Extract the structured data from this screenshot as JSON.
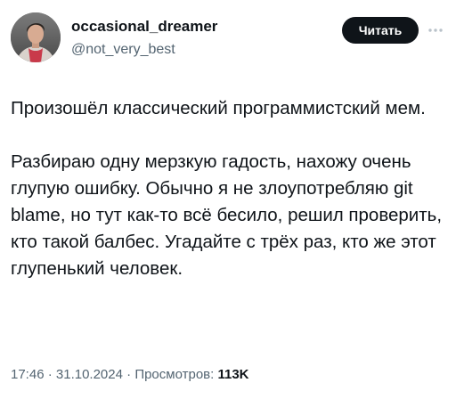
{
  "author": {
    "display_name": "occasional_dreamer",
    "handle": "@not_very_best"
  },
  "follow_button": {
    "label": "Читать"
  },
  "more_icon": "ellipsis-icon",
  "tweet": {
    "paragraphs": [
      "Произошёл классический программистский мем.",
      "Разбираю одну мерзкую гадость, нахожу очень глупую ошибку. Обычно я не злоупотребляю git blame, но тут как-то всё бесило, решил проверить, кто такой балбес. Угадайте с трёх раз, кто же этот глупенький человек."
    ]
  },
  "meta": {
    "time": "17:46",
    "separator": " · ",
    "date": "31.10.2024",
    "views_label": "Просмотров: ",
    "views_count": "113K"
  },
  "colors": {
    "text": "#0f1419",
    "secondary": "#536471",
    "button_bg": "#0f1419",
    "button_text": "#ffffff"
  }
}
